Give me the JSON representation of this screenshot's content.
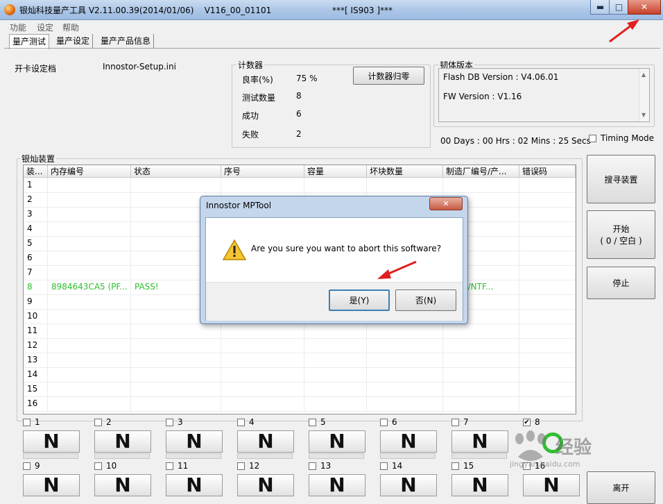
{
  "window": {
    "title": "银灿科技量产工具 V2.11.00.39(2014/01/06)    V116_00_01101                       ***[ IS903 ]***",
    "controls": {
      "minimize": "▬",
      "maximize": "□",
      "close": "✕"
    }
  },
  "menu": [
    "功能",
    "设定",
    "帮助"
  ],
  "tabs": [
    "量产测试",
    "量产设定",
    "量产产品信息"
  ],
  "config": {
    "label": "开卡设定档",
    "value": "Innostor-Setup.ini"
  },
  "counter": {
    "legend": "计数器",
    "rows": [
      {
        "label": "良率(%)",
        "value": "75 %"
      },
      {
        "label": "测试数量",
        "value": "8"
      },
      {
        "label": "成功",
        "value": "6"
      },
      {
        "label": "失败",
        "value": "2"
      }
    ],
    "reset_button": "计数器归零"
  },
  "firmware": {
    "legend": "韧体版本",
    "flash_db": "Flash DB Version :  V4.06.01",
    "fw": "FW Version :    V1.16"
  },
  "timer": "00 Days : 00 Hrs : 02 Mins : 25 Secs",
  "timing_mode": {
    "label": "Timing Mode",
    "checked": false
  },
  "devices": {
    "legend": "银灿装置",
    "columns": [
      "装...",
      "内存编号",
      "状态",
      "序号",
      "容量",
      "坏块数量",
      "制造厂编号/产...",
      "错误码"
    ],
    "rows": [
      [
        "1",
        "",
        "",
        "",
        "",
        "",
        "",
        ""
      ],
      [
        "2",
        "",
        "",
        "",
        "",
        "",
        "",
        ""
      ],
      [
        "3",
        "",
        "",
        "",
        "",
        "",
        "",
        ""
      ],
      [
        "4",
        "",
        "",
        "",
        "",
        "",
        "",
        ""
      ],
      [
        "5",
        "",
        "",
        "",
        "",
        "",
        "",
        ""
      ],
      [
        "6",
        "",
        "",
        "",
        "",
        "",
        "",
        ""
      ],
      [
        "7",
        "",
        "",
        "",
        "",
        "",
        "",
        ""
      ],
      [
        "8",
        "8984643CA5 (PF...",
        "PASS!",
        "",
        "",
        "",
        "0903/NTF...",
        ""
      ],
      [
        "9",
        "",
        "",
        "",
        "",
        "",
        "",
        ""
      ],
      [
        "10",
        "",
        "",
        "",
        "",
        "",
        "",
        ""
      ],
      [
        "11",
        "",
        "",
        "",
        "",
        "",
        "",
        ""
      ],
      [
        "12",
        "",
        "",
        "",
        "",
        "",
        "",
        ""
      ],
      [
        "13",
        "",
        "",
        "",
        "",
        "",
        "",
        ""
      ],
      [
        "14",
        "",
        "",
        "",
        "",
        "",
        "",
        ""
      ],
      [
        "15",
        "",
        "",
        "",
        "",
        "",
        "",
        ""
      ],
      [
        "16",
        "",
        "",
        "",
        "",
        "",
        "",
        ""
      ]
    ],
    "highlight_row": 7,
    "highlight_color": "#2fbf2f"
  },
  "side_buttons": {
    "search": "搜寻装置",
    "start_line1": "开始",
    "start_line2": "( 0 / 空白  )",
    "stop": "停止",
    "exit": "离开"
  },
  "slots": [
    {
      "num": "1",
      "checked": false,
      "glyph": "N"
    },
    {
      "num": "2",
      "checked": false,
      "glyph": "N"
    },
    {
      "num": "3",
      "checked": false,
      "glyph": "N"
    },
    {
      "num": "4",
      "checked": false,
      "glyph": "N"
    },
    {
      "num": "5",
      "checked": false,
      "glyph": "N"
    },
    {
      "num": "6",
      "checked": false,
      "glyph": "N"
    },
    {
      "num": "7",
      "checked": false,
      "glyph": "N"
    },
    {
      "num": "8",
      "checked": true,
      "glyph": ""
    },
    {
      "num": "9",
      "checked": false,
      "glyph": "N"
    },
    {
      "num": "10",
      "checked": false,
      "glyph": "N"
    },
    {
      "num": "11",
      "checked": false,
      "glyph": "N"
    },
    {
      "num": "12",
      "checked": false,
      "glyph": "N"
    },
    {
      "num": "13",
      "checked": false,
      "glyph": "N"
    },
    {
      "num": "14",
      "checked": false,
      "glyph": "N"
    },
    {
      "num": "15",
      "checked": false,
      "glyph": "N"
    },
    {
      "num": "16",
      "checked": false,
      "glyph": "N"
    }
  ],
  "dialog": {
    "title": "Innostor MPTool",
    "message": "Are you sure you want to abort this software?",
    "yes": "是(Y)",
    "no": "否(N)",
    "close": "✕"
  },
  "watermark": {
    "text": "经验",
    "url": "jingyan.baidu.com"
  },
  "colors": {
    "pass_green": "#2fbf2f",
    "arrow_red": "#e02020",
    "slot_ok_green": "#2fbf2f"
  }
}
